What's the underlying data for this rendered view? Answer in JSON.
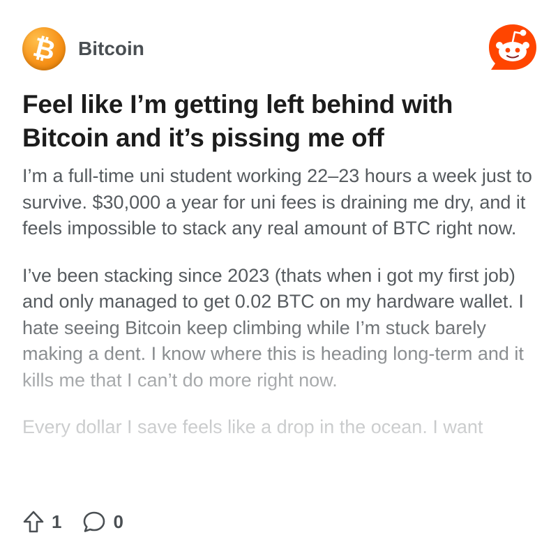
{
  "community": {
    "name": "Bitcoin",
    "icon": "bitcoin-logo",
    "icon_glyph": "₿",
    "accent": "#f7931a"
  },
  "app": {
    "logo": "reddit-logo",
    "accent": "#ff4500"
  },
  "post": {
    "title": "Feel like I’m getting left behind with Bitcoin and it’s pissing me off",
    "paragraphs": [
      "I’m a full-time uni student working 22–23 hours a week just to survive. $30,000 a year for uni fees is draining me dry, and it feels impossible to stack any real amount of BTC right now.",
      "I’ve been stacking since 2023 (thats when i got my first job) and only managed to get 0.02 BTC on my hardware wallet. I hate seeing Bitcoin keep climbing while I’m stuck barely making a dent. I know where this is heading long-term and it kills me that I can’t do more right now.",
      "Every dollar I save feels like a drop in the ocean. I want"
    ]
  },
  "actions": {
    "upvotes": "1",
    "comments": "0",
    "upvote_icon": "upvote-arrow-icon",
    "comment_icon": "comment-bubble-icon"
  }
}
